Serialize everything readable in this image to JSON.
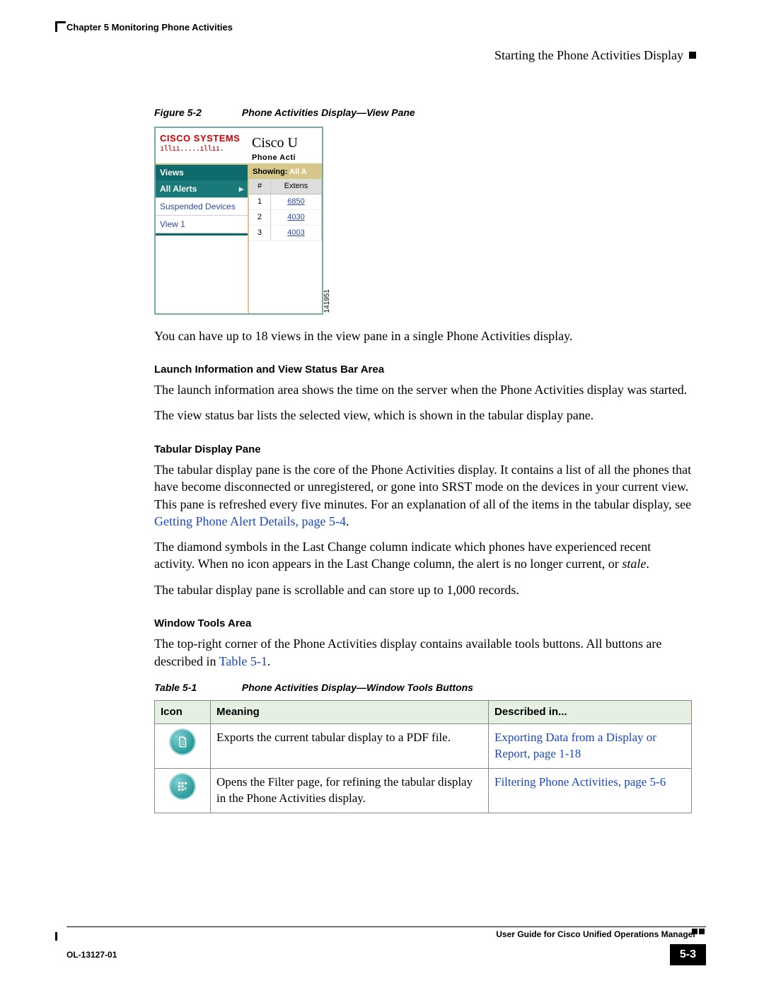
{
  "header": {
    "chapter": "Chapter 5    Monitoring Phone Activities",
    "section": "Starting the Phone Activities Display"
  },
  "figure": {
    "label": "Figure 5-2",
    "title": "Phone Activities Display—View Pane",
    "logo_text": "CISCO SYSTEMS",
    "app_title": "Cisco U",
    "app_sub": "Phone Acti",
    "showing_label": "Showing: ",
    "showing_value": "All A",
    "side_header": "Views",
    "side_items": [
      "All Alerts",
      "Suspended Devices",
      "View 1"
    ],
    "grid_headers": [
      "#",
      "Extens"
    ],
    "grid_rows": [
      {
        "n": "1",
        "ext": "6850"
      },
      {
        "n": "2",
        "ext": "4030"
      },
      {
        "n": "3",
        "ext": "4003"
      }
    ],
    "fig_id": "141951"
  },
  "para_after_fig": "You can have up to 18 views in the view pane in a single Phone Activities display.",
  "sect_launch": {
    "heading": "Launch Information and View Status Bar Area",
    "p1": "The launch information area shows the time on the server when the Phone Activities display was started.",
    "p2": "The view status bar lists the selected view, which is shown in the tabular display pane."
  },
  "sect_tabular": {
    "heading": "Tabular Display Pane",
    "p1a": "The tabular display pane is the core of the Phone Activities display. It contains a list of all the phones that have become disconnected or unregistered, or gone into SRST mode on the devices in your current view. This pane is refreshed every five minutes. For an explanation of all of the items in the tabular display, see ",
    "p1_link": "Getting Phone Alert Details, page 5-4",
    "p1b": ".",
    "p2a": "The diamond symbols in the Last Change column indicate which phones have experienced recent activity. When no icon appears in the Last Change column, the alert is no longer current, or ",
    "p2_ital": "stale",
    "p2b": ".",
    "p3": "The tabular display pane is scrollable and can store up to 1,000 records."
  },
  "sect_tools": {
    "heading": "Window Tools Area",
    "p1a": "The top-right corner of the Phone Activities display contains available tools buttons. All buttons are described in ",
    "p1_link": "Table 5-1",
    "p1b": "."
  },
  "table": {
    "label": "Table 5-1",
    "title": "Phone Activities Display—Window Tools Buttons",
    "headers": [
      "Icon",
      "Meaning",
      "Described in..."
    ],
    "rows": [
      {
        "meaning": "Exports the current tabular display to a PDF file.",
        "link": "Exporting Data from a Display or Report, page 1-18"
      },
      {
        "meaning": "Opens the Filter page, for refining the tabular display in the Phone Activities display.",
        "link": "Filtering Phone Activities, page 5-6"
      }
    ]
  },
  "footer": {
    "guide": "User Guide for Cisco Unified Operations Manager",
    "ol": "OL-13127-01",
    "page": "5-3"
  }
}
